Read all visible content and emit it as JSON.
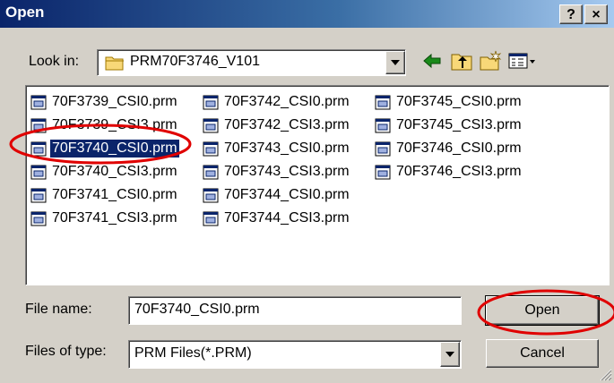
{
  "window": {
    "title": "Open"
  },
  "title_buttons": {
    "help": "?",
    "close": "×"
  },
  "look_in": {
    "label": "Look in:",
    "value": "PRM70F3746_V101"
  },
  "toolbar": {
    "icons": [
      "back-arrow-icon",
      "up-folder-icon",
      "new-folder-icon",
      "view-menu-icon"
    ]
  },
  "files": [
    "70F3739_CSI0.prm",
    "70F3739_CSI3.prm",
    "70F3740_CSI0.prm",
    "70F3740_CSI3.prm",
    "70F3741_CSI0.prm",
    "70F3741_CSI3.prm",
    "70F3742_CSI0.prm",
    "70F3742_CSI3.prm",
    "70F3743_CSI0.prm",
    "70F3743_CSI3.prm",
    "70F3744_CSI0.prm",
    "70F3744_CSI3.prm",
    "70F3745_CSI0.prm",
    "70F3745_CSI3.prm",
    "70F3746_CSI0.prm",
    "70F3746_CSI3.prm"
  ],
  "selected_file": "70F3740_CSI0.prm",
  "file_name": {
    "label": "File name:",
    "value": "70F3740_CSI0.prm"
  },
  "file_type": {
    "label": "Files of type:",
    "value": "PRM Files(*.PRM)"
  },
  "buttons": {
    "open": "Open",
    "cancel": "Cancel"
  },
  "colors": {
    "selection": "#0a246a",
    "annotation": "#e00000",
    "face": "#d4d0c8"
  }
}
